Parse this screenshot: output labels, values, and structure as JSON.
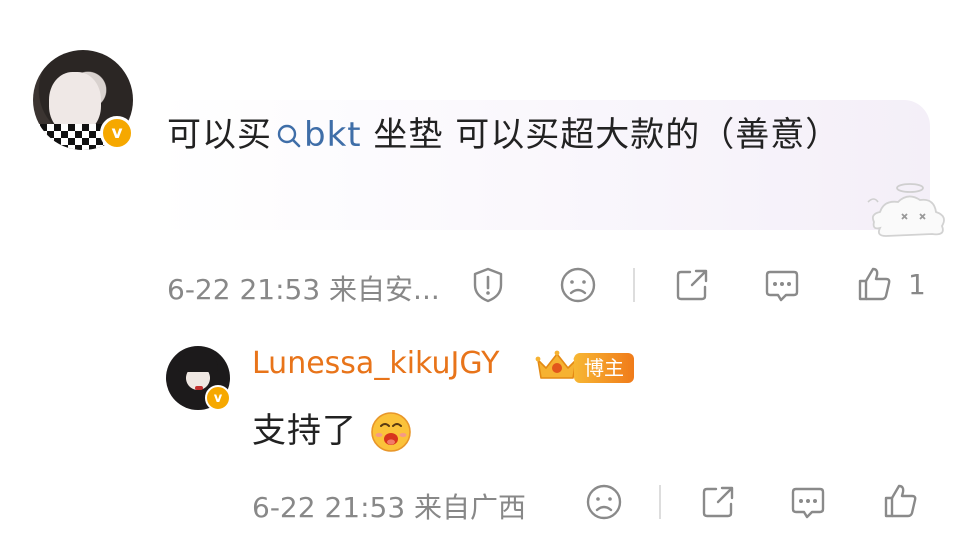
{
  "comment": {
    "text_part1": "可以买",
    "link_text": "bkt",
    "text_part2": " 坐垫 可以买超大款的（善意）",
    "timestamp": "6-22 21:53",
    "location": "来自安...",
    "like_count": "1",
    "verified_badge": "v"
  },
  "reply": {
    "username": "Lunessa_kikuJGY",
    "author_badge": "博主",
    "text": "支持了",
    "timestamp": "6-22 21:53",
    "location": "来自广西",
    "verified_badge": "v"
  },
  "colors": {
    "username": "#e8741a",
    "link": "#3f6ea8",
    "meta": "#888888",
    "badge": "#f6a800"
  }
}
